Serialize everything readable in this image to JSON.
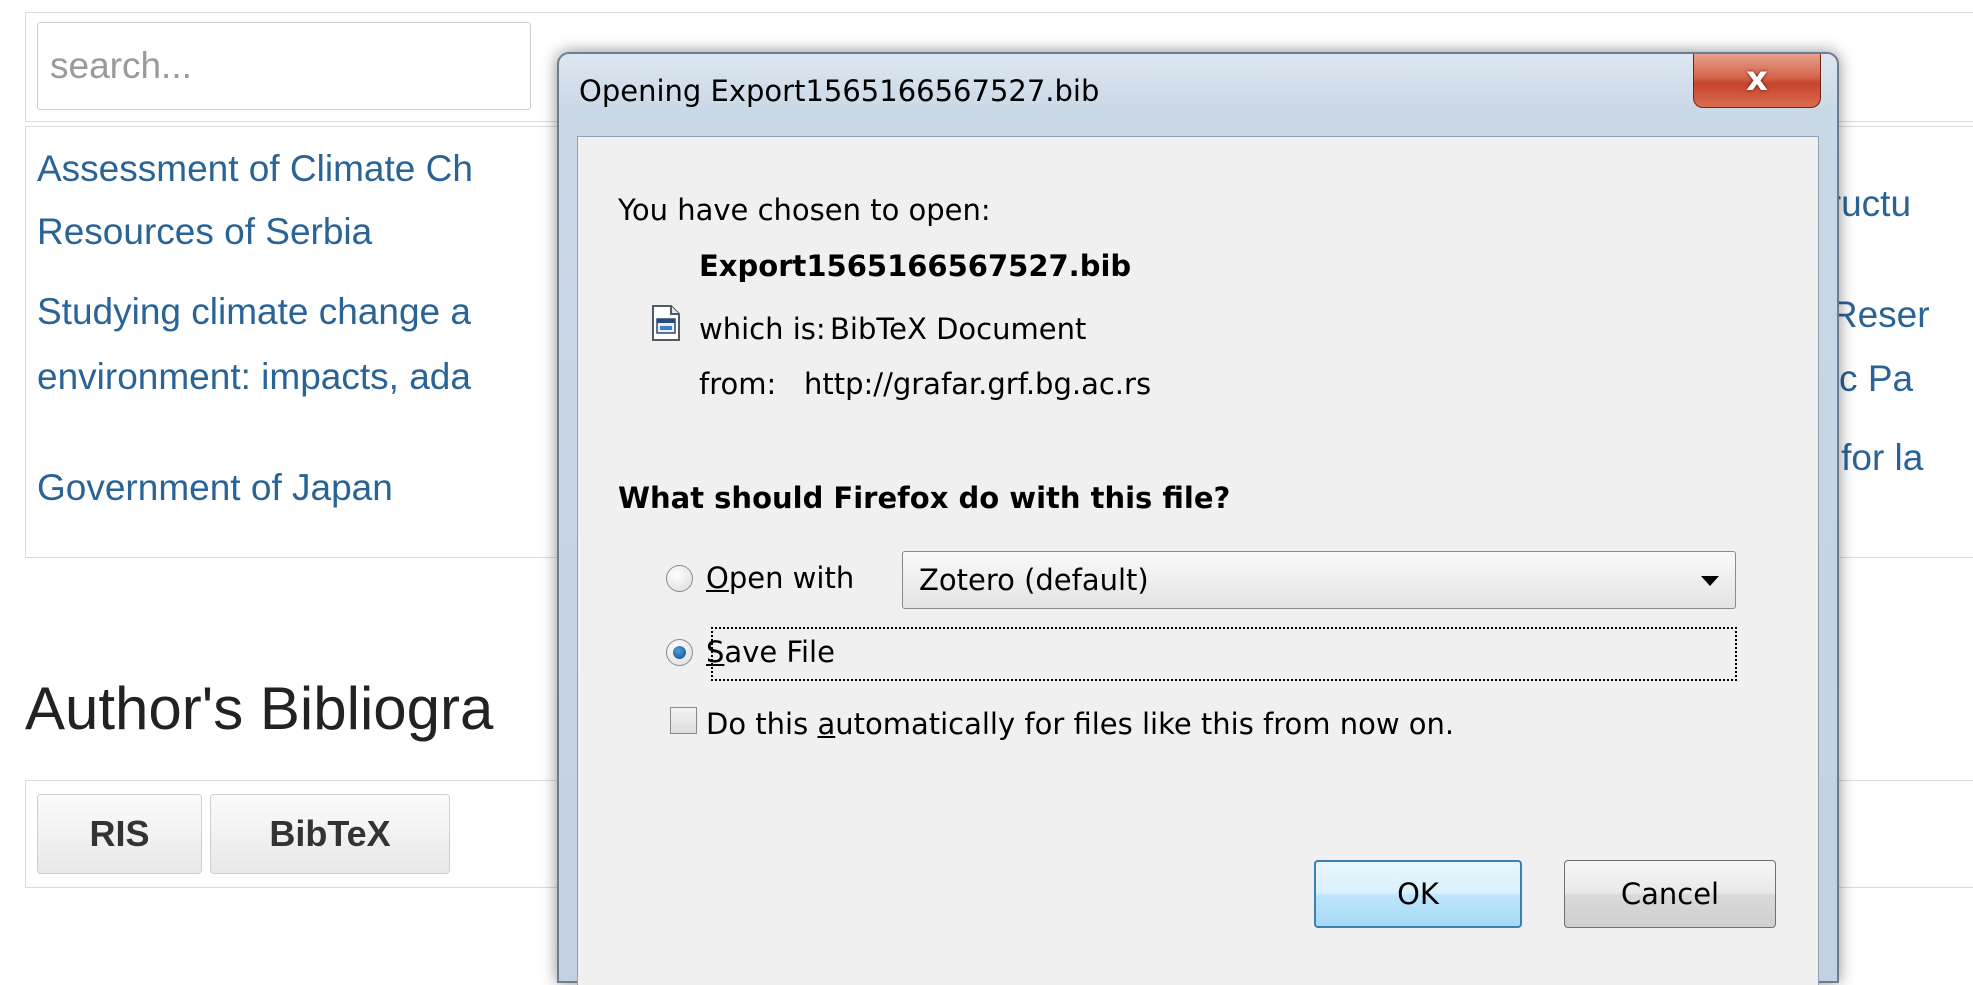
{
  "page": {
    "search": {
      "placeholder": "search..."
    },
    "results": {
      "left_items": [
        {
          "line1": "Assessment of Climate Ch",
          "line2": "Resources of Serbia"
        },
        {
          "line1": "Studying climate change a",
          "line2": "environment: impacts, ada"
        },
        {
          "line1": "Government of Japan"
        }
      ],
      "right_items": [
        {
          "text": "structu"
        },
        {
          "line1": "d Reser",
          "line2": "mic Pa"
        },
        {
          "text": "m for la"
        }
      ]
    },
    "section_title": "Author's Bibliogra",
    "export_buttons": {
      "ris": "RIS",
      "bibtex": "BibTeX"
    }
  },
  "dialog": {
    "title": "Opening Export1565166567527.bib",
    "close_label": "x",
    "chosen_label": "You have chosen to open:",
    "filename": "Export1565166567527.bib",
    "type_label": "which is:",
    "type_value": "BibTeX Document",
    "from_label": "from:",
    "from_value": "http://grafar.grf.bg.ac.rs",
    "question": "What should Firefox do with this file?",
    "open_with_key": "O",
    "open_with_rest": "pen with",
    "app_value": "Zotero (default)",
    "save_key": "S",
    "save_rest": "ave File",
    "auto_pre": "Do this ",
    "auto_key": "a",
    "auto_post": "utomatically for files like this from now on.",
    "ok_label": "OK",
    "cancel_label": "Cancel",
    "colors": {
      "link": "#2a6496",
      "ok_border": "#3c7fb1",
      "close_red": "#c5432a"
    },
    "state": {
      "selected_option": "save_file",
      "auto_checked": false
    }
  }
}
